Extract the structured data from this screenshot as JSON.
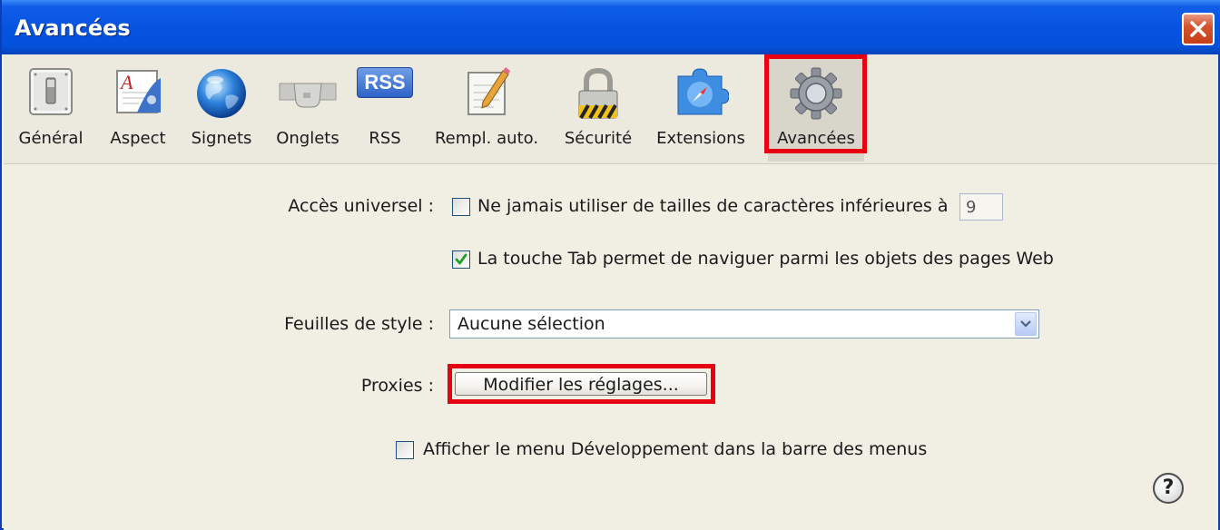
{
  "window": {
    "title": "Avancées"
  },
  "toolbar": {
    "items": [
      {
        "label": "Général",
        "icon": "switch-icon"
      },
      {
        "label": "Aspect",
        "icon": "font-icon"
      },
      {
        "label": "Signets",
        "icon": "globe-icon"
      },
      {
        "label": "Onglets",
        "icon": "tabs-icon"
      },
      {
        "label": "RSS",
        "icon": "rss-icon",
        "badge": "RSS"
      },
      {
        "label": "Rempl. auto.",
        "icon": "pencil-form-icon"
      },
      {
        "label": "Sécurité",
        "icon": "padlock-icon"
      },
      {
        "label": "Extensions",
        "icon": "compass-puzzle-icon"
      },
      {
        "label": "Avancées",
        "icon": "gear-icon",
        "selected": true
      }
    ]
  },
  "content": {
    "universal_access_label": "Accès universel :",
    "min_font_label": "Ne jamais utiliser de tailles de caractères inférieures à",
    "min_font_checked": false,
    "min_font_value": "9",
    "tab_nav_label": "La touche Tab permet de naviguer parmi les objets des pages Web",
    "tab_nav_checked": true,
    "stylesheet_label": "Feuilles de style :",
    "stylesheet_value": "Aucune sélection",
    "proxies_label": "Proxies :",
    "proxies_button": "Modifier les réglages...",
    "develop_label": "Afficher le menu Développement dans la barre des menus",
    "develop_checked": false,
    "help_glyph": "?"
  },
  "colors": {
    "highlight": "#e60012",
    "titlebar": "#0753e0",
    "checkmark": "#21a121"
  }
}
